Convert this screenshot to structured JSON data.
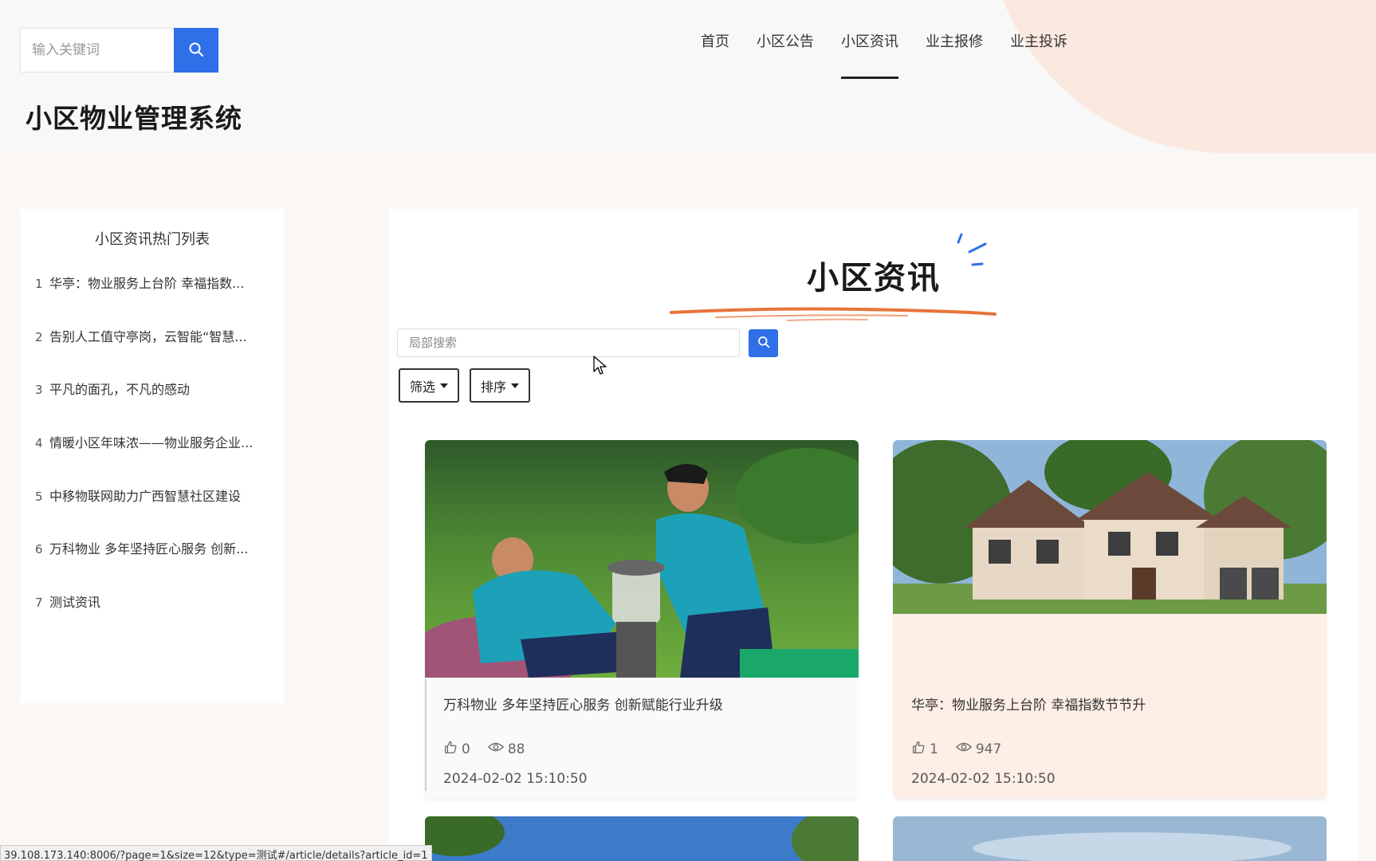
{
  "header": {
    "search_placeholder": "输入关键词",
    "site_title": "小区物业管理系统",
    "nav": [
      "首页",
      "小区公告",
      "小区资讯",
      "业主报修",
      "业主投诉"
    ],
    "active_nav": "小区资讯"
  },
  "sidebar": {
    "title": "小区资讯热门列表",
    "items": [
      {
        "num": "1",
        "label": "华亭：物业服务上台阶 幸福指数..."
      },
      {
        "num": "2",
        "label": "告别人工值守亭岗，云智能“智慧..."
      },
      {
        "num": "3",
        "label": "平凡的面孔，不凡的感动"
      },
      {
        "num": "4",
        "label": "情暖小区年味浓——物业服务企业..."
      },
      {
        "num": "5",
        "label": "中移物联网助力广西智慧社区建设"
      },
      {
        "num": "6",
        "label": "万科物业 多年坚持匠心服务 创新..."
      },
      {
        "num": "7",
        "label": "测试资讯"
      }
    ]
  },
  "main": {
    "title": "小区资讯",
    "local_search_placeholder": "局部搜索",
    "filter_label": "筛选",
    "sort_label": "排序",
    "cards": [
      {
        "title": "万科物业 多年坚持匠心服务 创新赋能行业升级",
        "likes": "0",
        "views": "88",
        "date": "2024-02-02 15:10:50"
      },
      {
        "title": "华亭：物业服务上台阶 幸福指数节节升",
        "likes": "1",
        "views": "947",
        "date": "2024-02-02 15:10:50"
      }
    ]
  },
  "status_bar": {
    "url": "39.108.173.140:8006/?page=1&size=12&type=测试#/article/details?article_id=1"
  },
  "colors": {
    "accent_blue": "#2f6fe8",
    "header_blob": "#fbe9df",
    "card_alt": "#fdeee6",
    "brush_orange": "#e8743b"
  },
  "icons": [
    "search-icon",
    "like-icon",
    "eye-icon",
    "cursor-icon",
    "caret-down-icon"
  ]
}
